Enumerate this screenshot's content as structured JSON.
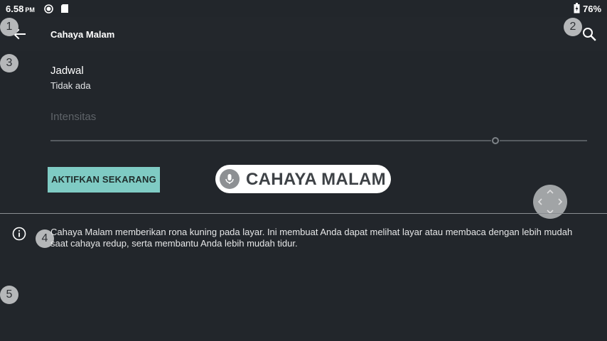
{
  "status_bar": {
    "time": "6.58",
    "ampm": "PM",
    "battery": "76%"
  },
  "app_bar": {
    "title": "Cahaya Malam"
  },
  "markers": [
    "1",
    "2",
    "3",
    "4",
    "5"
  ],
  "schedule": {
    "title": "Jadwal",
    "value": "Tidak ada"
  },
  "intensity": {
    "label": "Intensitas",
    "level_fraction": 0.82
  },
  "activate_button": {
    "label": "AKTIFKAN SEKARANG"
  },
  "voice_overlay": {
    "text": "CAHAYA MALAM"
  },
  "info": {
    "text": "Cahaya Malam memberikan rona kuning pada layar. Ini membuat Anda dapat melihat layar atau membaca dengan lebih mudah saat cahaya redup, serta membantu Anda lebih mudah tidur."
  },
  "colors": {
    "background": "#22262b",
    "accent_button": "#7fcbc4",
    "marker": "#b5b7b9"
  },
  "icons": [
    "back-arrow-icon",
    "search-icon",
    "info-icon",
    "mic-icon",
    "battery-icon",
    "notification-icon",
    "sd-card-icon",
    "dpad-icon"
  ]
}
